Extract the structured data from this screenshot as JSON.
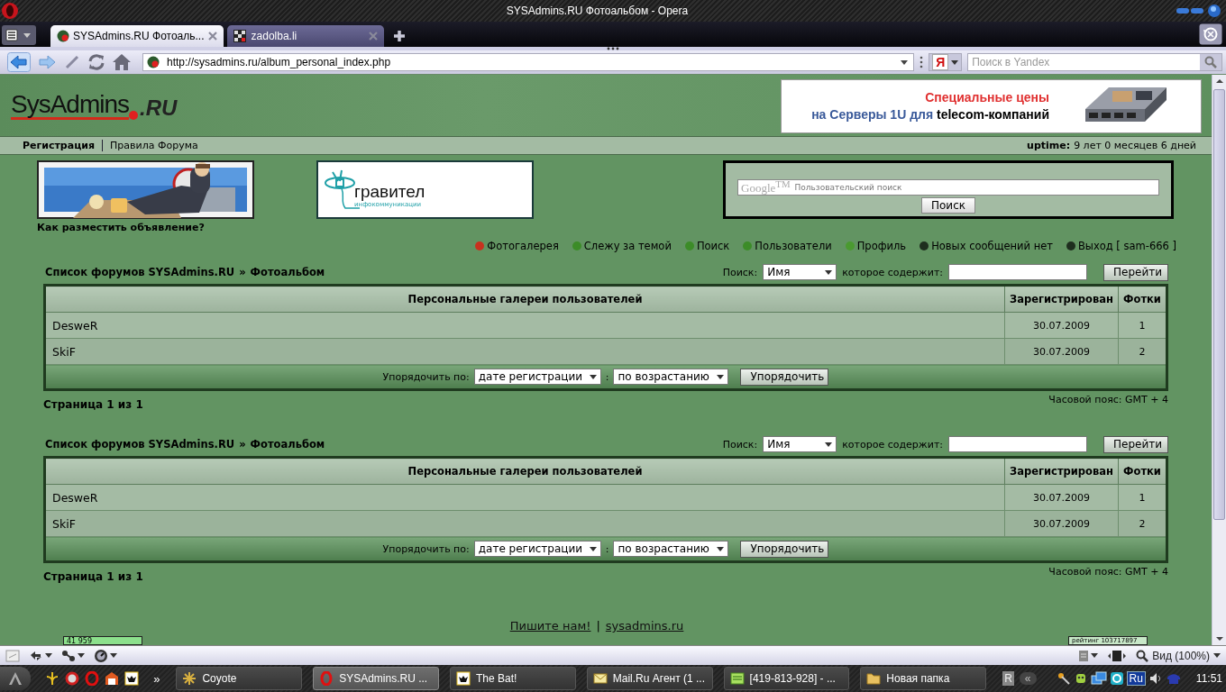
{
  "window": {
    "title": "SYSAdmins.RU Фотоальбом - Opera"
  },
  "tabs": [
    {
      "label": "SYSAdmins.RU Фотоаль...",
      "selected": true
    },
    {
      "label": "zadolba.li",
      "selected": false
    }
  ],
  "address_bar": {
    "url": "http://sysadmins.ru/album_personal_index.php",
    "search_engine": "Я",
    "search_placeholder": "Поиск в Yandex"
  },
  "header": {
    "logo": {
      "name": "SysAdmins",
      "suffix": ".RU"
    },
    "ad": {
      "headline": "Специальные цены",
      "line_start": "на Серверы 1U для",
      "line_end": "telecom-компаний"
    }
  },
  "nav": {
    "items": [
      {
        "label": "Регистрация",
        "current": true
      },
      {
        "label": "Правила Форума",
        "current": false
      }
    ],
    "uptime_label": "uptime:",
    "uptime_value": "9 лет 0 месяцев 6 дней"
  },
  "banners": {
    "caption": "Как разместить объявление?",
    "partner": {
      "name": "гравител",
      "tagline": "инфокоммуникации"
    },
    "search": {
      "brand": "Google$^{TM}$",
      "placeholder": "Пользовательский поиск",
      "button": "Поиск"
    }
  },
  "menu": [
    {
      "label": "Фотогалерея",
      "color": "#c8321e"
    },
    {
      "label": "Слежу за темой",
      "color": "#3c8c28"
    },
    {
      "label": "Поиск",
      "color": "#3c8c28"
    },
    {
      "label": "Пользователи",
      "color": "#3c8c28"
    },
    {
      "label": "Профиль",
      "color": "#4a9a30"
    },
    {
      "label": "Новых сообщений нет",
      "color": "#1e2e1e"
    },
    {
      "label": "Выход [ sam-666 ]",
      "color": "#1e2e1e"
    }
  ],
  "sections": [
    {
      "breadcrumb": {
        "forum_index": "Список форумов SYSAdmins.RU",
        "separator": "»",
        "current": "Фотоальбом"
      },
      "search": {
        "label": "Поиск:",
        "field": "Имя",
        "contains_label": "которое содержит:",
        "button": "Перейти"
      },
      "table": {
        "columns": [
          "Персональные галереи пользователей",
          "Зарегистрирован",
          "Фотки"
        ],
        "rows": [
          {
            "user": "DesweR",
            "registered": "30.07.2009",
            "photos": "1"
          },
          {
            "user": "SkiF",
            "registered": "30.07.2009",
            "photos": "2"
          }
        ]
      },
      "sort": {
        "label": "Упорядочить по:",
        "field": "дате регистрации",
        "separator": ":",
        "order": "по возрастанию",
        "button": "Упорядочить"
      },
      "pagination": "Страница 1 из 1",
      "timezone": "Часовой пояс: GMT + 4"
    },
    {
      "breadcrumb": {
        "forum_index": "Список форумов SYSAdmins.RU",
        "separator": "»",
        "current": "Фотоальбом"
      },
      "search": {
        "label": "Поиск:",
        "field": "Имя",
        "contains_label": "которое содержит:",
        "button": "Перейти"
      },
      "table": {
        "columns": [
          "Персональные галереи пользователей",
          "Зарегистрирован",
          "Фотки"
        ],
        "rows": [
          {
            "user": "DesweR",
            "registered": "30.07.2009",
            "photos": "1"
          },
          {
            "user": "SkiF",
            "registered": "30.07.2009",
            "photos": "2"
          }
        ]
      },
      "sort": {
        "label": "Упорядочить по:",
        "field": "дате регистрации",
        "separator": ":",
        "order": "по возрастанию",
        "button": "Упорядочить"
      },
      "pagination": "Страница 1 из 1",
      "timezone": "Часовой пояс: GMT + 4"
    }
  ],
  "footer": {
    "links": [
      "Пишите нам!",
      "sysadmins.ru"
    ],
    "separator": "|",
    "counters": [
      "41 959",
      "рейтинг 103717897"
    ]
  },
  "status_bar": {
    "zoom": "Вид (100%)"
  },
  "taskbar": {
    "overflow": "»",
    "items": [
      {
        "label": "Coyote",
        "selected": false
      },
      {
        "label": "SYSAdmins.RU ...",
        "selected": true
      },
      {
        "label": "The Bat!",
        "selected": false
      },
      {
        "label": "Mail.Ru Агент (1 ...",
        "selected": false
      },
      {
        "label": "[419-813-928] - ...",
        "selected": false
      },
      {
        "label": "Новая папка",
        "selected": false
      }
    ],
    "language_bar": "R",
    "collapse": "«",
    "tray_language": "Ru",
    "clock": "11:51"
  }
}
